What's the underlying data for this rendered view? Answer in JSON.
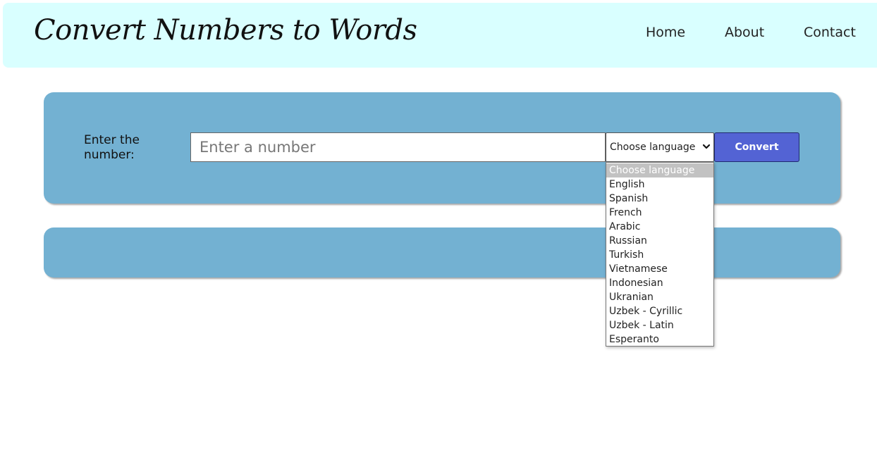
{
  "header": {
    "title": "Convert Numbers to Words",
    "nav": {
      "home": "Home",
      "about": "About",
      "contact": "Contact"
    }
  },
  "form": {
    "label": "Enter the number:",
    "input_placeholder": "Enter a number",
    "input_value": "",
    "language_selected": "Choose language",
    "convert_label": "Convert"
  },
  "language_options": [
    "Choose language",
    "English",
    "Spanish",
    "French",
    "Arabic",
    "Russian",
    "Turkish",
    "Vietnamese",
    "Indonesian",
    "Ukranian",
    "Uzbek - Cyrillic",
    "Uzbek - Latin",
    "Esperanto"
  ],
  "result": {
    "text": ""
  },
  "icons": {
    "select_arrow": "chevron-down-icon"
  },
  "colors": {
    "header_bg": "#d9ffff",
    "card_bg": "#73b1d2",
    "button_bg": "#5363d4",
    "highlight_bg": "#c2c2c2"
  }
}
